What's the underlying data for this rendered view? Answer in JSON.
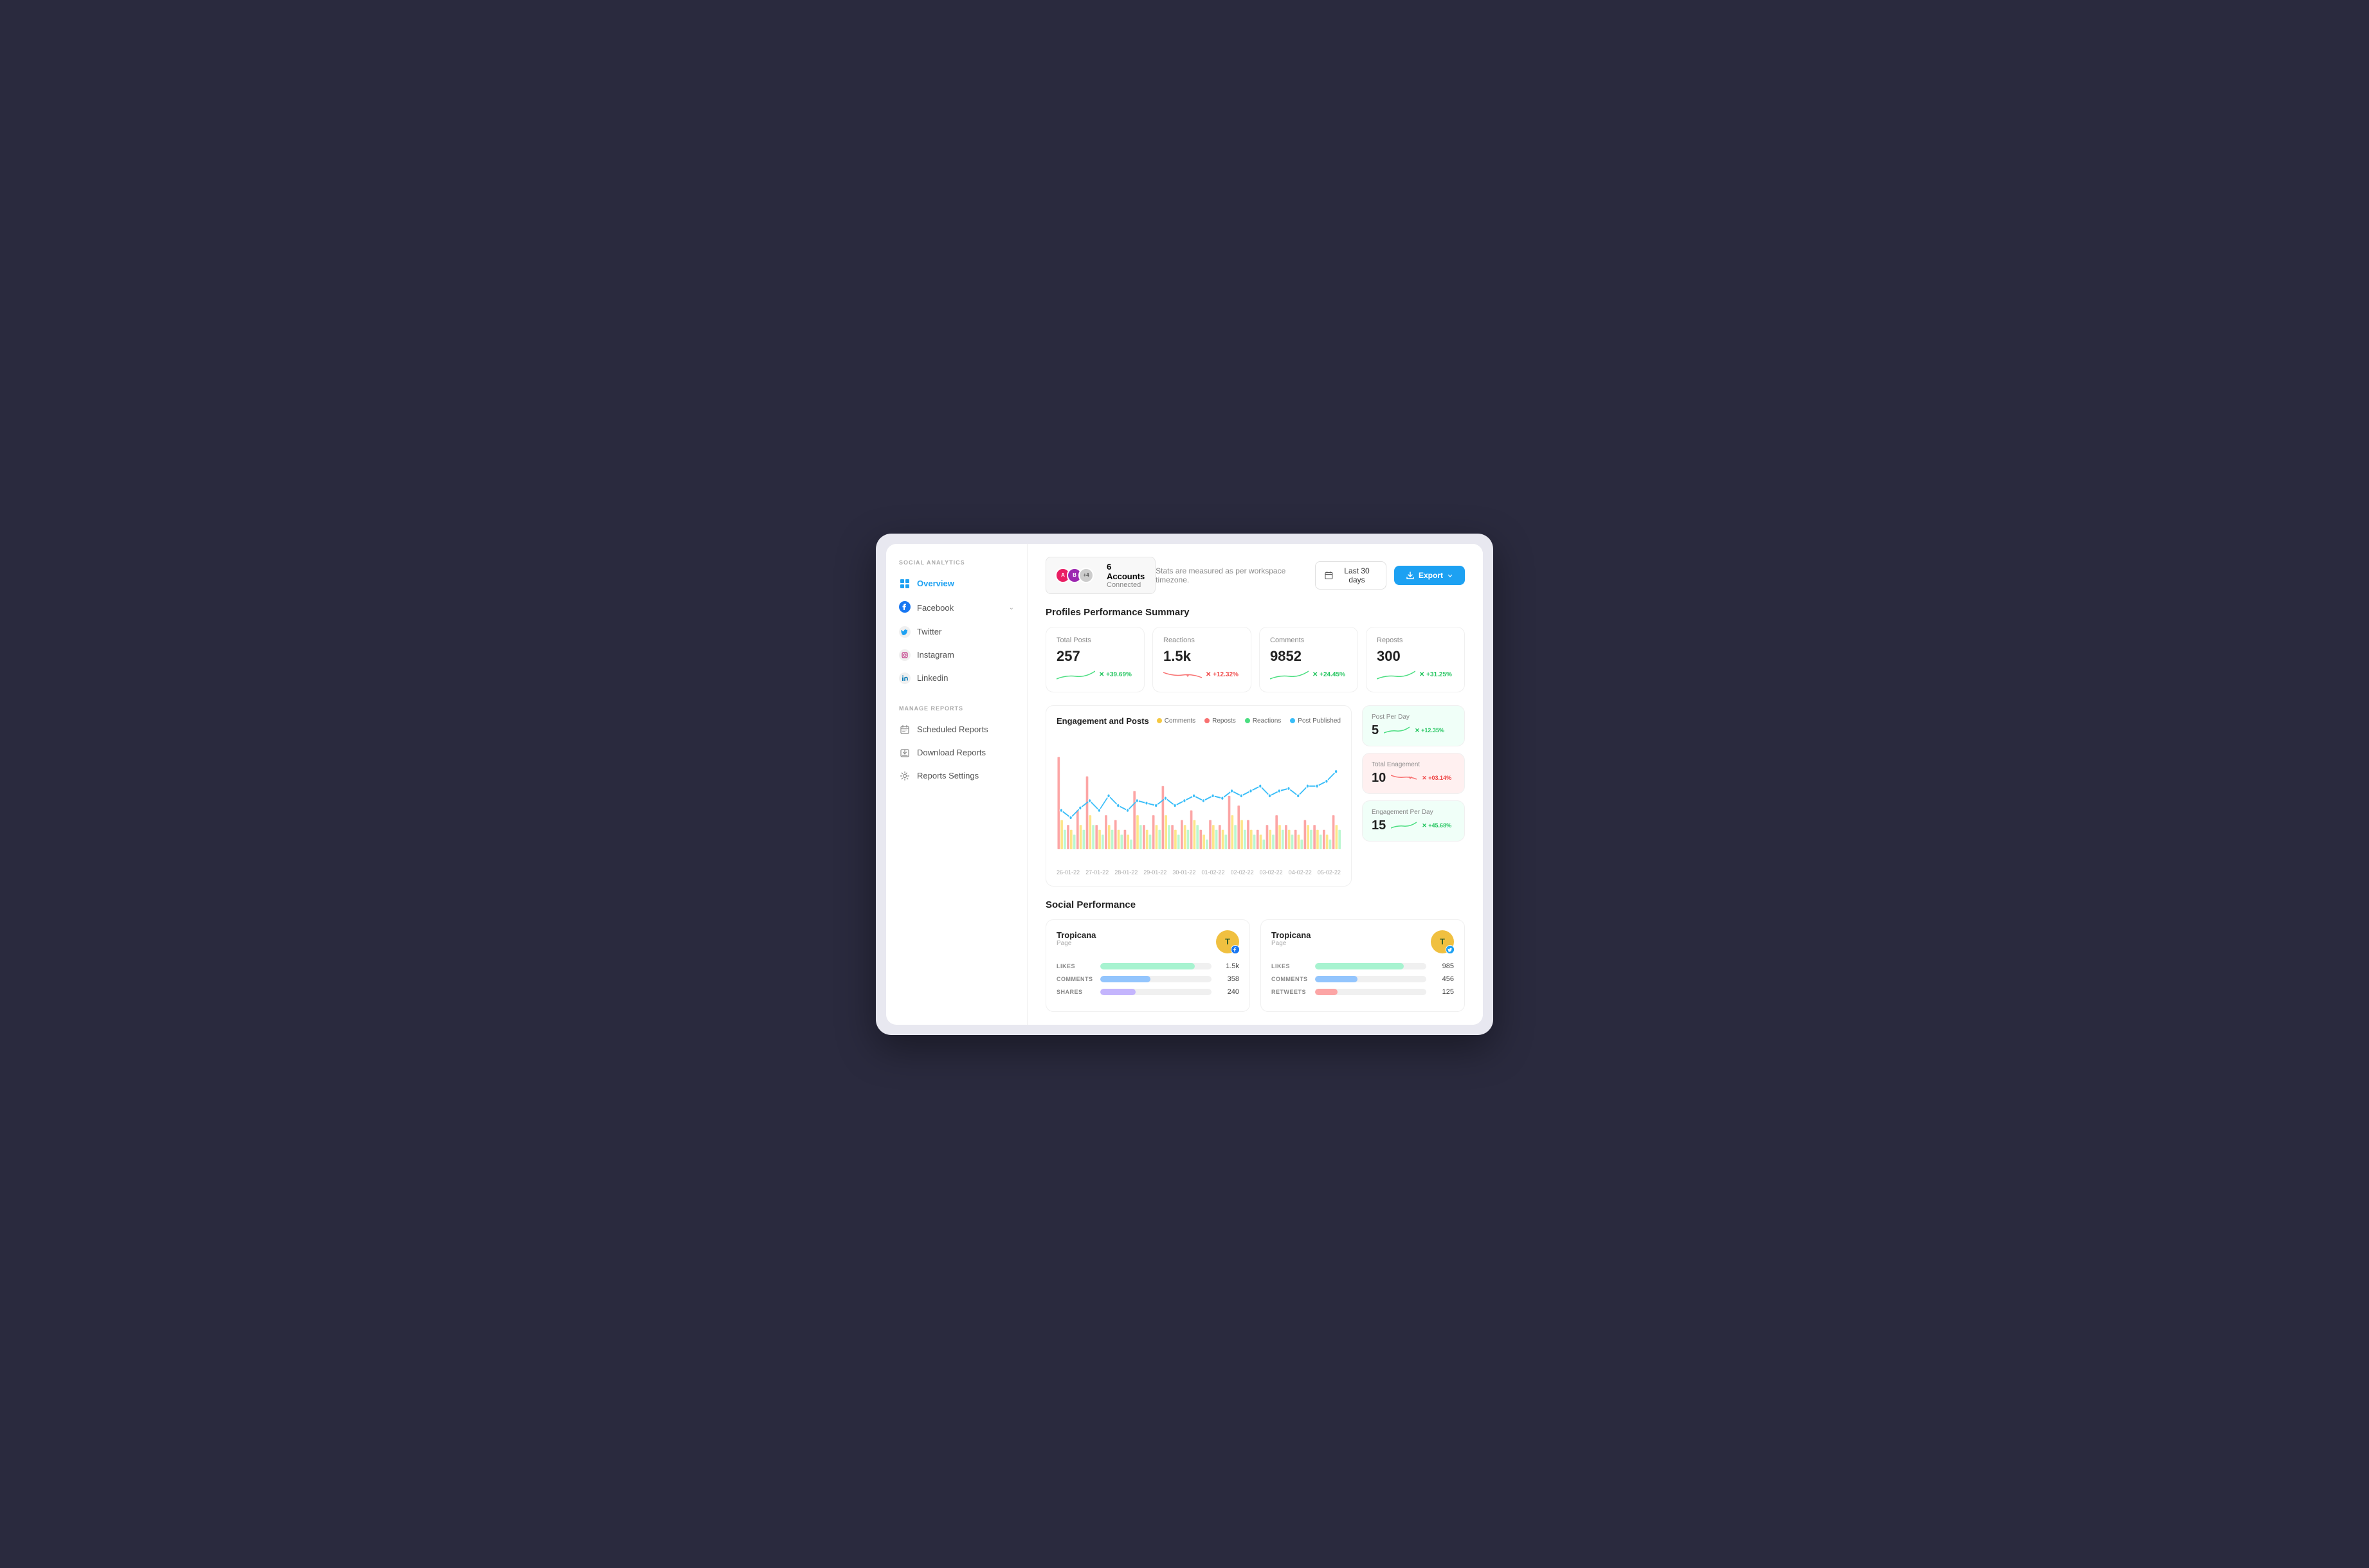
{
  "app": {
    "title": "Social Analytics"
  },
  "sidebar": {
    "section_social": "SOCIAL ANALYTICS",
    "section_reports": "MANAGE REPORTS",
    "items": [
      {
        "id": "overview",
        "label": "Overview",
        "active": true
      },
      {
        "id": "facebook",
        "label": "Facebook",
        "active": false
      },
      {
        "id": "twitter",
        "label": "Twitter",
        "active": false
      },
      {
        "id": "instagram",
        "label": "Instagram",
        "active": false
      },
      {
        "id": "linkedin",
        "label": "Linkedin",
        "active": false
      }
    ],
    "report_items": [
      {
        "id": "scheduled",
        "label": "Scheduled Reports"
      },
      {
        "id": "download",
        "label": "Download Reports"
      },
      {
        "id": "settings",
        "label": "Reports Settings"
      }
    ]
  },
  "topbar": {
    "accounts_count": "6 Accounts",
    "accounts_sub": "Connected",
    "avatar_plus": "+4",
    "timezone_text": "Stats are measured as per workspace timezone.",
    "date_range": "Last 30 days",
    "export_label": "Export"
  },
  "profiles_section": {
    "title": "Profiles Performance Summary",
    "stats": [
      {
        "label": "Total Posts",
        "value": "257",
        "change": "+39.69%",
        "positive": true
      },
      {
        "label": "Reactions",
        "value": "1.5k",
        "change": "+12.32%",
        "positive": false
      },
      {
        "label": "Comments",
        "value": "9852",
        "change": "+24.45%",
        "positive": true
      },
      {
        "label": "Reposts",
        "value": "300",
        "change": "+31.25%",
        "positive": true
      }
    ]
  },
  "chart": {
    "title": "Engagement and Posts",
    "legend": [
      {
        "label": "Comments",
        "color": "#f5c842"
      },
      {
        "label": "Reposts",
        "color": "#f87171"
      },
      {
        "label": "Reactions",
        "color": "#4ade80"
      },
      {
        "label": "Post Published",
        "color": "#38bdf8"
      }
    ],
    "x_labels": [
      "26-01-22",
      "27-01-22",
      "28-01-22",
      "29-01-22",
      "30-01-22",
      "01-02-22",
      "02-02-22",
      "03-02-22",
      "04-02-22",
      "05-02-22"
    ],
    "bar_data_red": [
      38,
      10,
      16,
      30,
      10,
      14,
      12,
      8,
      24,
      10,
      14,
      26,
      10,
      12,
      16,
      8,
      12,
      10,
      22,
      18,
      12,
      8,
      10,
      14,
      10,
      8,
      12,
      10,
      8,
      14
    ],
    "bar_data_yellow": [
      12,
      8,
      10,
      14,
      8,
      10,
      8,
      6,
      14,
      8,
      10,
      14,
      8,
      10,
      12,
      6,
      10,
      8,
      14,
      12,
      8,
      6,
      8,
      10,
      8,
      6,
      10,
      8,
      6,
      10
    ],
    "bar_data_green": [
      8,
      6,
      8,
      10,
      6,
      8,
      6,
      4,
      10,
      6,
      8,
      10,
      6,
      8,
      10,
      4,
      8,
      6,
      10,
      8,
      6,
      4,
      6,
      8,
      6,
      4,
      8,
      6,
      4,
      8
    ],
    "line_data": [
      16,
      13,
      17,
      20,
      16,
      22,
      18,
      16,
      20,
      19,
      18,
      21,
      18,
      20,
      22,
      20,
      22,
      21,
      24,
      22,
      24,
      26,
      22,
      24,
      25,
      22,
      26,
      26,
      28,
      32
    ]
  },
  "side_metrics": [
    {
      "label": "Post Per Day",
      "value": "5",
      "change": "+12.35%",
      "positive": true
    },
    {
      "label": "Total Enagement",
      "value": "10",
      "change": "+03.14%",
      "positive": false
    },
    {
      "label": "Engagement Per Day",
      "value": "15",
      "change": "+45.68%",
      "positive": true
    }
  ],
  "social_performance": {
    "title": "Social Performance",
    "cards": [
      {
        "name": "Tropicana",
        "subtitle": "Page",
        "platform": "facebook",
        "platform_color": "#1877f2",
        "bars": [
          {
            "label": "LIKES",
            "value": "1.5k",
            "pct": 85,
            "color": "#a7f3d0"
          },
          {
            "label": "COMMENTS",
            "value": "358",
            "pct": 45,
            "color": "#93c5fd"
          },
          {
            "label": "SHARES",
            "value": "240",
            "pct": 32,
            "color": "#c4b5fd"
          }
        ]
      },
      {
        "name": "Tropicana",
        "subtitle": "Page",
        "platform": "twitter",
        "platform_color": "#1da1f2",
        "bars": [
          {
            "label": "LIKES",
            "value": "985",
            "pct": 80,
            "color": "#a7f3d0"
          },
          {
            "label": "COMMENTS",
            "value": "456",
            "pct": 38,
            "color": "#93c5fd"
          },
          {
            "label": "RETWEETS",
            "value": "125",
            "pct": 20,
            "color": "#fca5a5"
          }
        ]
      }
    ]
  }
}
